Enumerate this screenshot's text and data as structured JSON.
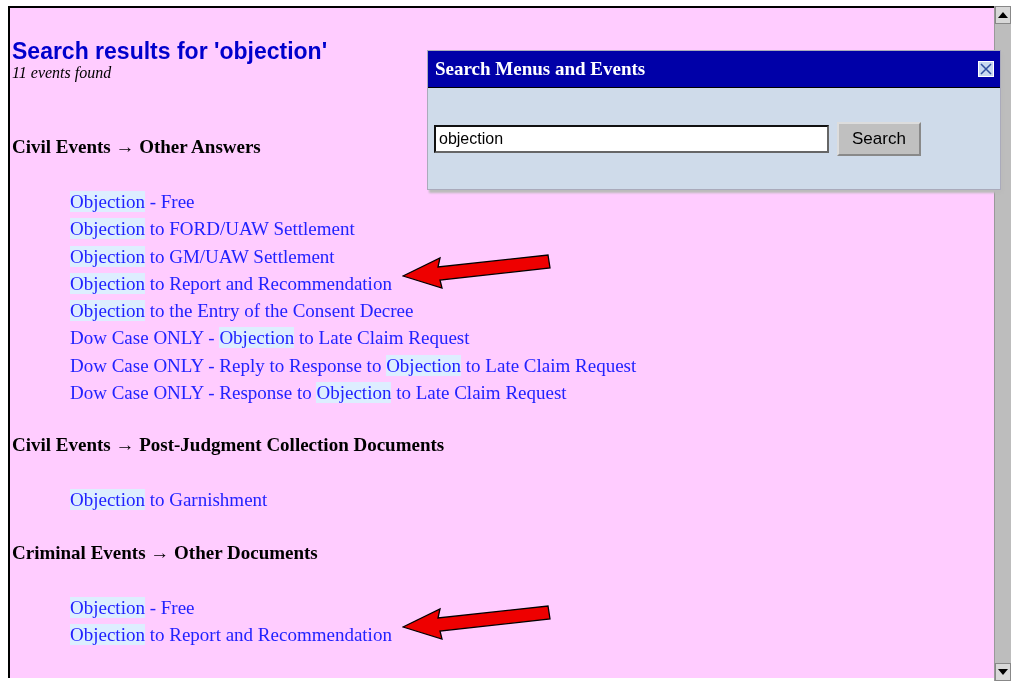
{
  "heading": "Search results for 'objection'",
  "count": "11 events found",
  "groups": [
    {
      "category": "Civil Events",
      "arrow": "→",
      "subcategory": "Other Answers",
      "items": [
        {
          "match": "Objection",
          "after": " - Free",
          "arrow": false
        },
        {
          "match": "Objection",
          "after": " to FORD/UAW Settlement",
          "arrow": false
        },
        {
          "match": "Objection",
          "after": " to GM/UAW Settlement",
          "arrow": false
        },
        {
          "match": "Objection",
          "after": " to Report and Recommendation",
          "arrow": true
        },
        {
          "match": "Objection",
          "after": " to the Entry of the Consent Decree",
          "arrow": false
        },
        {
          "before": "Dow Case ONLY - ",
          "match": "Objection",
          "after": " to Late Claim Request",
          "arrow": false
        },
        {
          "before": "Dow Case ONLY - Reply to Response to ",
          "match": "Objection",
          "after": " to Late Claim Request",
          "arrow": false
        },
        {
          "before": "Dow Case ONLY - Response to ",
          "match": "Objection",
          "after": " to Late Claim Request",
          "arrow": false
        }
      ]
    },
    {
      "category": "Civil Events",
      "arrow": "→",
      "subcategory": "Post-Judgment Collection Documents",
      "items": [
        {
          "match": "Objection",
          "after": " to Garnishment",
          "arrow": false
        }
      ]
    },
    {
      "category": "Criminal Events",
      "arrow": "→",
      "subcategory": "Other Documents",
      "items": [
        {
          "match": "Objection",
          "after": " - Free",
          "arrow": false
        },
        {
          "match": "Objection",
          "after": " to Report and Recommendation",
          "arrow": true
        }
      ]
    }
  ],
  "dialog": {
    "title": "Search Menus and Events",
    "search_value": "objection",
    "button": "Search"
  }
}
